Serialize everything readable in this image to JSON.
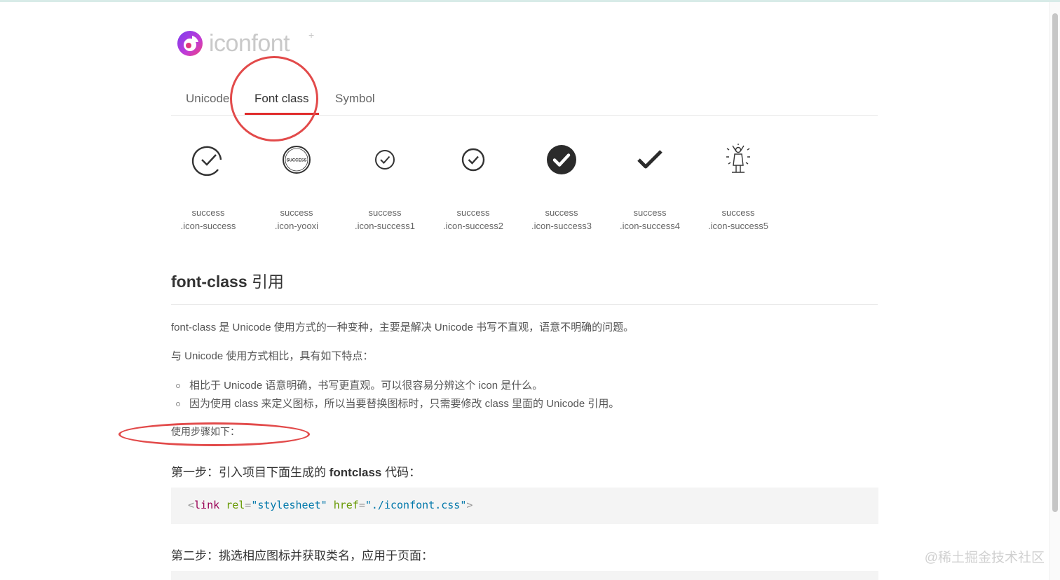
{
  "logo": {
    "wordmark": "iconfont",
    "plus": "+"
  },
  "tabs": [
    {
      "label": "Unicode",
      "active": false
    },
    {
      "label": "Font class",
      "active": true
    },
    {
      "label": "Symbol",
      "active": false
    }
  ],
  "icons": [
    {
      "name": "success",
      "class": ".icon-success",
      "icon": "circle-check-outline-icon"
    },
    {
      "name": "success",
      "class": ".icon-yooxi",
      "icon": "success-stamp-icon",
      "stamp_text": "SUCCESS"
    },
    {
      "name": "success",
      "class": ".icon-success1",
      "icon": "circle-check-thin-icon"
    },
    {
      "name": "success",
      "class": ".icon-success2",
      "icon": "circle-check-icon"
    },
    {
      "name": "success",
      "class": ".icon-success3",
      "icon": "circle-check-filled-icon"
    },
    {
      "name": "success",
      "class": ".icon-success4",
      "icon": "check-mark-icon"
    },
    {
      "name": "success",
      "class": ".icon-success5",
      "icon": "celebrating-person-icon"
    }
  ],
  "section": {
    "title_en": "font-class",
    "title_cn": "引用",
    "intro": "font-class 是 Unicode 使用方式的一种变种，主要是解决 Unicode 书写不直观，语意不明确的问题。",
    "compare": "与 Unicode 使用方式相比，具有如下特点：",
    "bullets": [
      "相比于 Unicode 语意明确，书写更直观。可以很容易分辨这个 icon 是什么。",
      "因为使用 class 来定义图标，所以当要替换图标时，只需要修改 class 里面的 Unicode 引用。"
    ],
    "steps_label": "使用步骤如下：",
    "step1_prefix": "第一步：引入项目下面生成的 ",
    "step1_bold": "fontclass",
    "step1_suffix": " 代码：",
    "code1": {
      "open": "<",
      "tag": "link",
      "attr1": "rel",
      "eq1": "=",
      "val1": "\"stylesheet\"",
      "attr2": "href",
      "eq2": "=",
      "val2": "\"./iconfont.css\"",
      "close": ">"
    },
    "step2": "第二步：挑选相应图标并获取类名，应用于页面："
  },
  "watermark": "@稀土掘金技术社区",
  "colors": {
    "accent_red": "#e02c2c",
    "annotation": "#e24a4a",
    "code_bg": "#f4f4f4",
    "icon": "#333333"
  }
}
